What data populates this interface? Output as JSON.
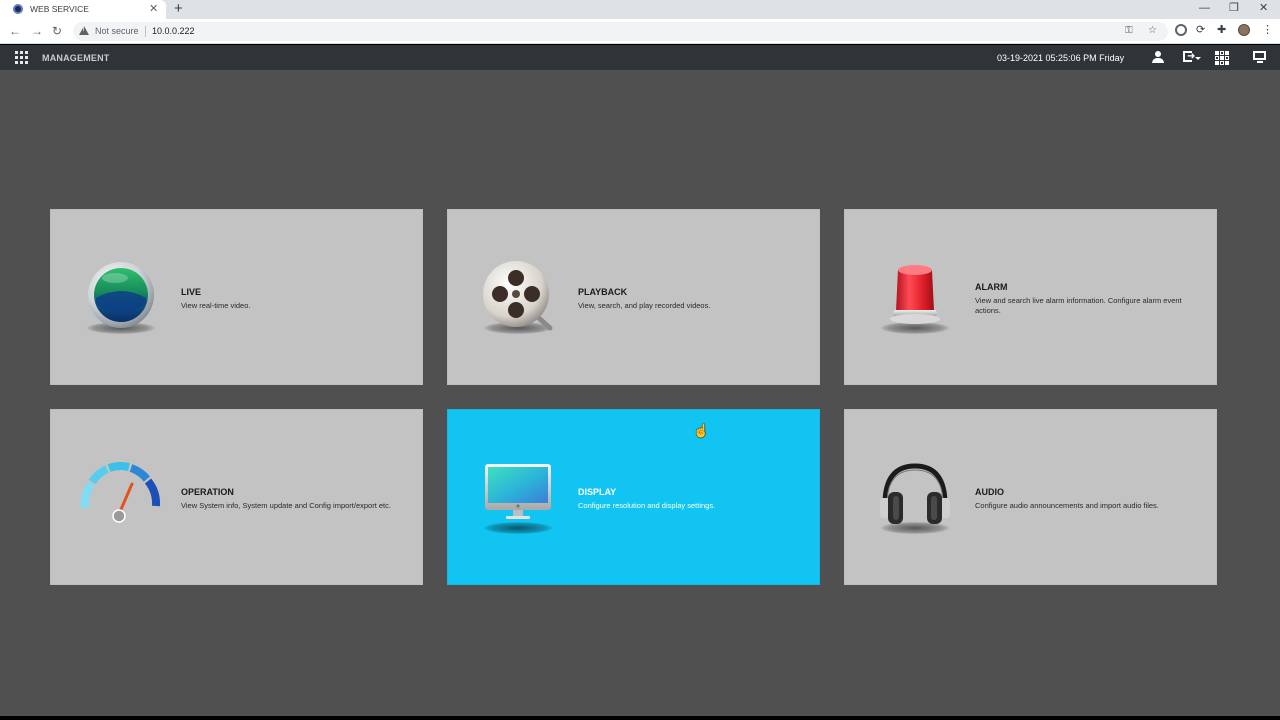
{
  "browser": {
    "tab_title": "WEB SERVICE",
    "tab_close": "✕",
    "new_tab": "+",
    "security_label": "Not secure",
    "url": "10.0.0.222",
    "window_controls": {
      "minimize": "—",
      "restore": "❐",
      "close": "✕"
    },
    "nav": {
      "back": "←",
      "forward": "→",
      "reload": "↻"
    }
  },
  "header": {
    "title": "MANAGEMENT",
    "datetime": "03-19-2021 05:25:06 PM Friday",
    "icons": [
      "menu-grid-icon",
      "user-icon",
      "logout-icon",
      "qr-code-icon",
      "monitor-icon"
    ]
  },
  "cards": [
    {
      "id": "live",
      "title": "LIVE",
      "description": "View real-time video.",
      "icon": "live-lens-icon",
      "active": false
    },
    {
      "id": "playback",
      "title": "PLAYBACK",
      "description": "View, search, and play recorded videos.",
      "icon": "film-reel-icon",
      "active": false
    },
    {
      "id": "alarm",
      "title": "ALARM",
      "description": "View and search live alarm information. Configure alarm event actions.",
      "icon": "alarm-siren-icon",
      "active": false
    },
    {
      "id": "operation",
      "title": "OPERATION",
      "description": "View System info, System update and Config import/export etc.",
      "icon": "speedometer-icon",
      "active": false
    },
    {
      "id": "display",
      "title": "DISPLAY",
      "description": "Configure resolution and display settings.",
      "icon": "display-monitor-icon",
      "active": true
    },
    {
      "id": "audio",
      "title": "AUDIO",
      "description": "Configure audio announcements and import audio files.",
      "icon": "headphones-icon",
      "active": false
    }
  ],
  "colors": {
    "background": "#505050",
    "header": "#2f3438",
    "card": "#c3c3c3",
    "card_active": "#12c4f2"
  }
}
